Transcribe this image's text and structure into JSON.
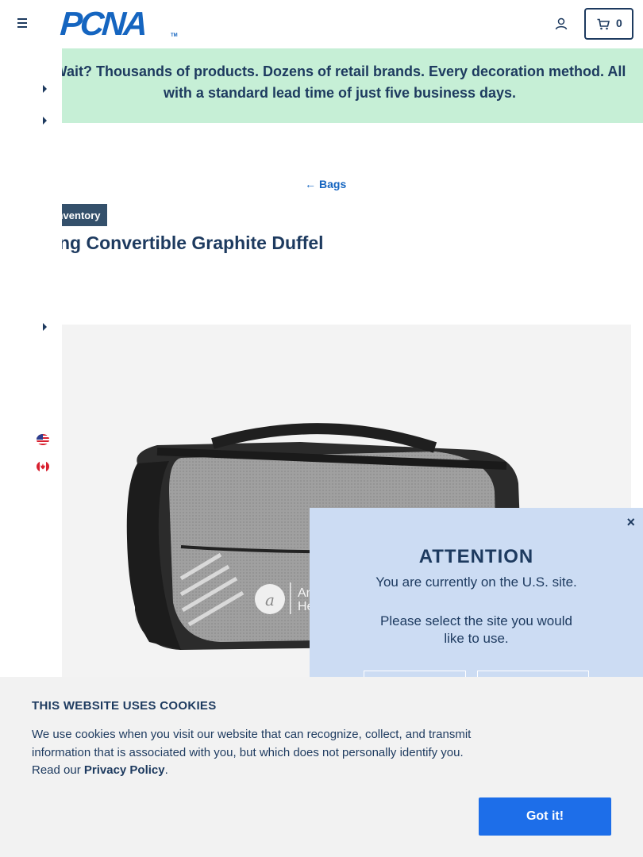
{
  "header": {
    "logo_text": "PCNA",
    "logo_tm": "TM",
    "cart_count": "0"
  },
  "banner": {
    "text": "Wait? Thousands of products. Dozens of retail brands. Every decoration method. All with a standard lead time of just five business days."
  },
  "breadcrumb": {
    "back_label": "Bags",
    "arrow": "←"
  },
  "product": {
    "badge": "Inventory",
    "title": "ng Convertible Graphite Duffel",
    "imprint_text_1": "Am",
    "imprint_text_2": "He"
  },
  "modal": {
    "close": "×",
    "title": "ATTENTION",
    "message": "You are currently on the U.S. site.",
    "prompt": "Please select the site you would like to use."
  },
  "cookie": {
    "title": "THIS WEBSITE USES COOKIES",
    "text_before": "We use cookies when you visit our website that can recognize, collect, and transmit information that is associated with you, but which does not personally identify you. Read our ",
    "link_label": "Privacy Policy",
    "text_after": ".",
    "button_label": "Got it!"
  },
  "colors": {
    "navy": "#1d3a5f",
    "brand_blue": "#1565c0",
    "banner_green": "#c6efd6",
    "modal_blue": "#ccdcf3",
    "button_blue": "#1d6ee9"
  }
}
